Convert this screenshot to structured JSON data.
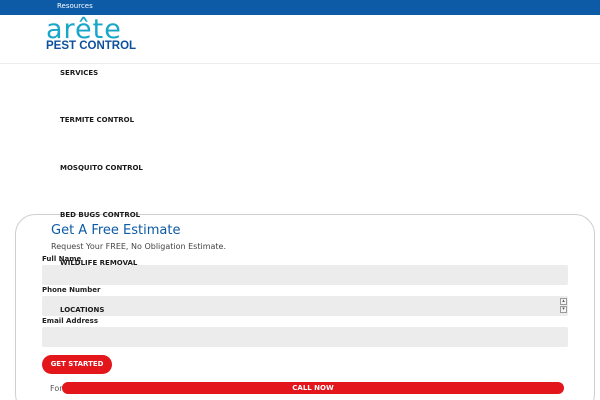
{
  "topbar": {
    "link": "Resources"
  },
  "logo": {
    "word": "arête",
    "sub": "PEST CONTROL"
  },
  "nav": {
    "items": [
      {
        "label": "SERVICES"
      },
      {
        "label": "TERMITE CONTROL"
      },
      {
        "label": "MOSQUITO CONTROL"
      },
      {
        "label": "BED BUGS CONTROL"
      },
      {
        "label": "WILDLIFE REMOVAL"
      },
      {
        "label": "LOCATIONS"
      }
    ]
  },
  "estimate": {
    "title": "Get A Free Estimate",
    "subtitle": "Request Your FREE, No Obligation Estimate.",
    "fields": {
      "full_name": {
        "label": "Full Name",
        "value": ""
      },
      "phone": {
        "label": "Phone Number",
        "value": ""
      },
      "email": {
        "label": "Email Address",
        "value": ""
      }
    },
    "submit_label": "GET STARTED"
  },
  "sticky": {
    "call_label": "CALL NOW"
  },
  "footer": {
    "fragment": "For"
  },
  "colors": {
    "brand_blue": "#0d5aa7",
    "logo_teal": "#1aa6c9",
    "cta_red": "#e3161b"
  }
}
